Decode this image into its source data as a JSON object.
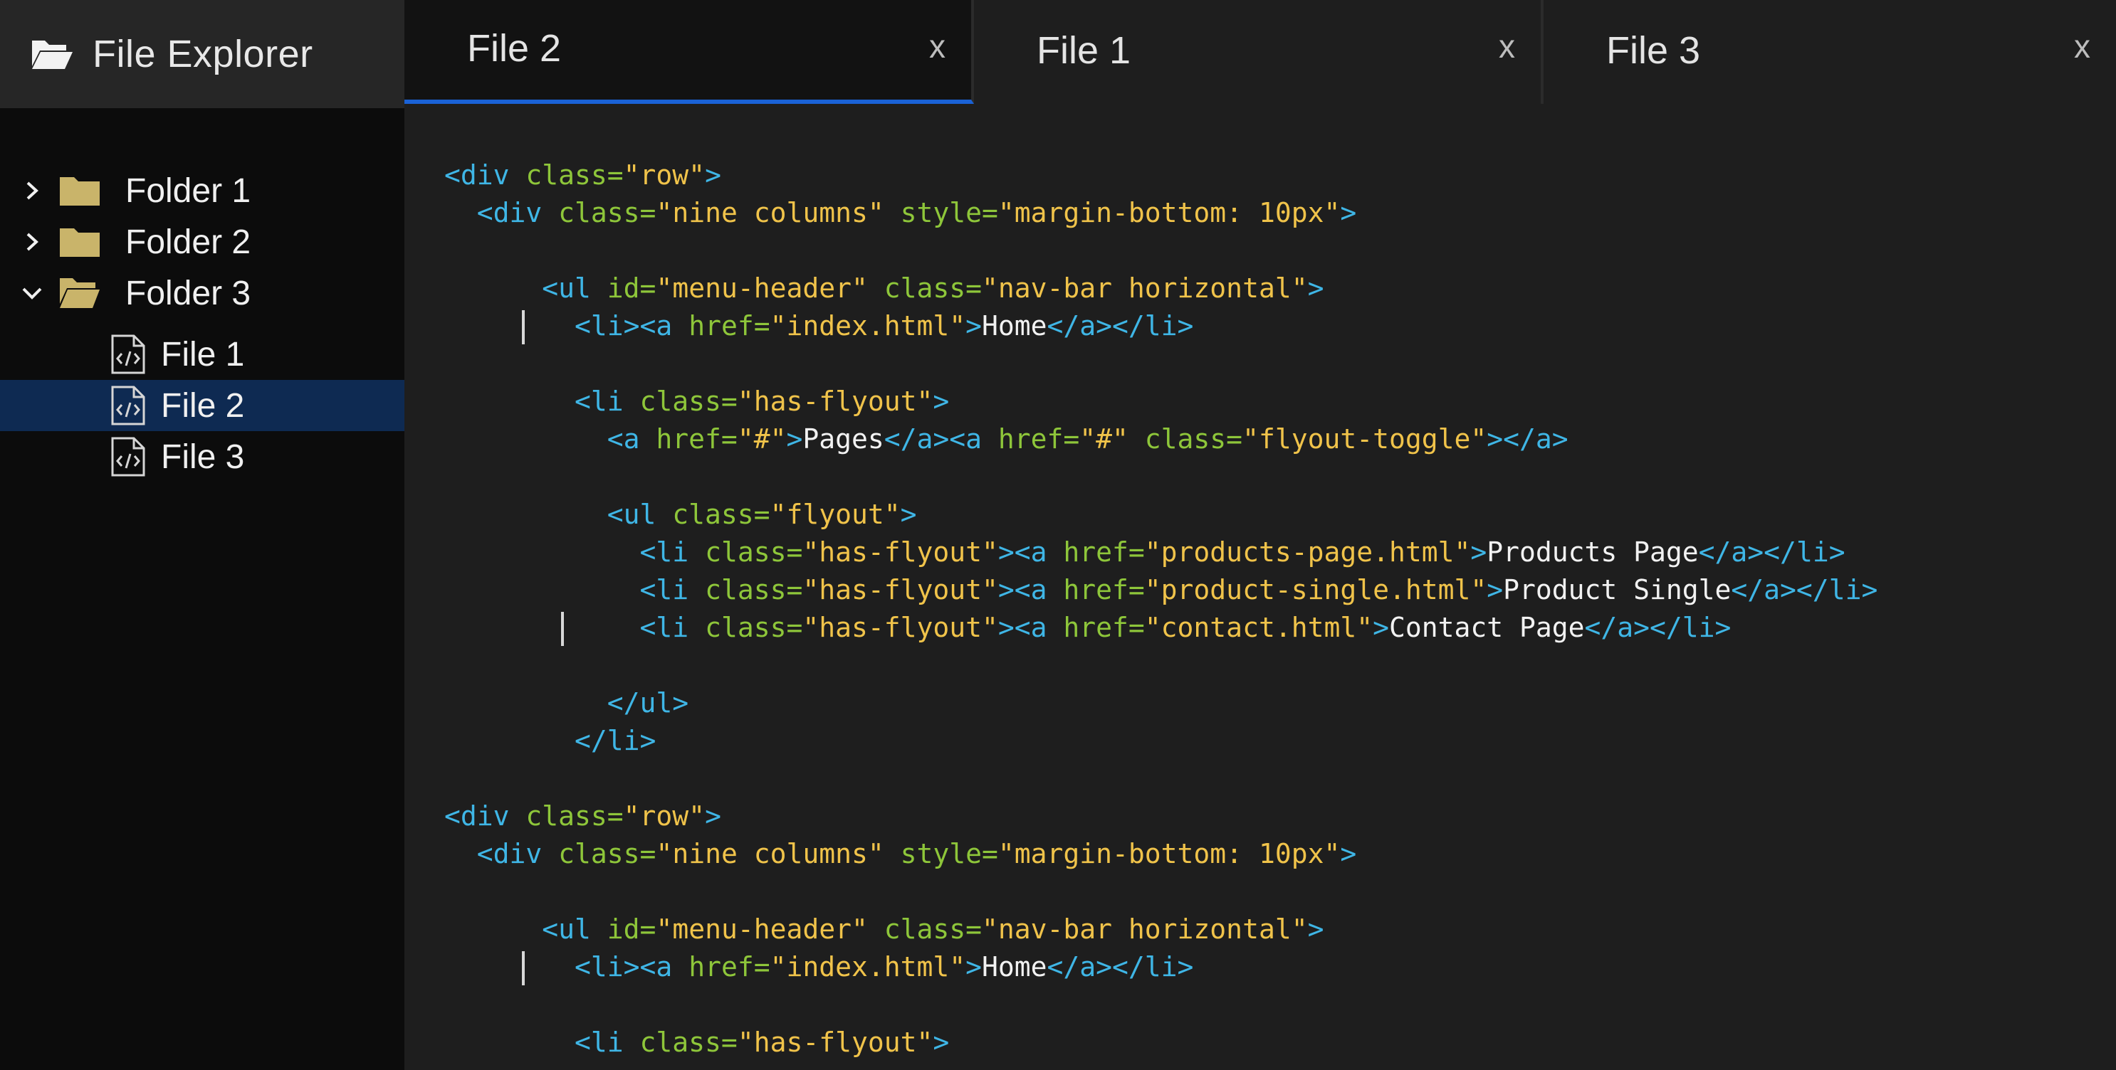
{
  "sidebar": {
    "title": "File Explorer",
    "header_icon": "folder-open-icon",
    "items": [
      {
        "type": "folder",
        "label": "Folder 1",
        "expanded": false
      },
      {
        "type": "folder",
        "label": "Folder 2",
        "expanded": false
      },
      {
        "type": "folder",
        "label": "Folder 3",
        "expanded": true
      },
      {
        "type": "file",
        "label": "File 1",
        "selected": false
      },
      {
        "type": "file",
        "label": "File 2",
        "selected": true
      },
      {
        "type": "file",
        "label": "File 3",
        "selected": false
      }
    ]
  },
  "tabs": [
    {
      "label": "File 2",
      "close": "x",
      "active": true
    },
    {
      "label": "File 1",
      "close": "x",
      "active": false
    },
    {
      "label": "File 3",
      "close": "x",
      "active": false
    }
  ],
  "colors": {
    "accent": "#1a62d6",
    "selected_row": "#0e2a52",
    "folder": "#c9b46a",
    "tag": "#3fb6e6",
    "attr": "#8ec63a",
    "string": "#f0c34a",
    "text": "#f2f2f2"
  },
  "code": {
    "lines": [
      {
        "indent": 0,
        "caret": false,
        "tokens": [
          [
            "tag",
            "<div "
          ],
          [
            "attr",
            "class="
          ],
          [
            "str",
            "\"row\""
          ],
          [
            "tag",
            ">"
          ]
        ]
      },
      {
        "indent": 1,
        "caret": false,
        "tokens": [
          [
            "tag",
            "<div "
          ],
          [
            "attr",
            "class="
          ],
          [
            "str",
            "\"nine columns\" "
          ],
          [
            "attr",
            "style="
          ],
          [
            "str",
            "\"margin-bottom: 10px\""
          ],
          [
            "tag",
            ">"
          ]
        ]
      },
      {
        "indent": 0,
        "caret": false,
        "tokens": []
      },
      {
        "indent": 3,
        "caret": false,
        "tokens": [
          [
            "tag",
            "<ul "
          ],
          [
            "attr",
            "id="
          ],
          [
            "str",
            "\"menu-header\" "
          ],
          [
            "attr",
            "class="
          ],
          [
            "str",
            "\"nav-bar horizontal\""
          ],
          [
            "tag",
            ">"
          ]
        ]
      },
      {
        "indent": 4,
        "caret": true,
        "tokens": [
          [
            "tag",
            "<li><a "
          ],
          [
            "attr",
            "href="
          ],
          [
            "str",
            "\"index.html\""
          ],
          [
            "tag",
            ">"
          ],
          [
            "txt",
            "Home"
          ],
          [
            "tag",
            "</a></li>"
          ]
        ]
      },
      {
        "indent": 0,
        "caret": false,
        "tokens": []
      },
      {
        "indent": 4,
        "caret": false,
        "tokens": [
          [
            "tag",
            "<li "
          ],
          [
            "attr",
            "class="
          ],
          [
            "str",
            "\"has-flyout\""
          ],
          [
            "tag",
            ">"
          ]
        ]
      },
      {
        "indent": 5,
        "caret": false,
        "tokens": [
          [
            "tag",
            "<a "
          ],
          [
            "attr",
            "href="
          ],
          [
            "str",
            "\"#\""
          ],
          [
            "tag",
            ">"
          ],
          [
            "txt",
            "Pages"
          ],
          [
            "tag",
            "</a><a "
          ],
          [
            "attr",
            "href="
          ],
          [
            "str",
            "\"#\" "
          ],
          [
            "attr",
            "class="
          ],
          [
            "str",
            "\"flyout-toggle\""
          ],
          [
            "tag",
            "></a>"
          ]
        ]
      },
      {
        "indent": 0,
        "caret": false,
        "tokens": []
      },
      {
        "indent": 5,
        "caret": false,
        "tokens": [
          [
            "tag",
            "<ul "
          ],
          [
            "attr",
            "class="
          ],
          [
            "str",
            "\"flyout\""
          ],
          [
            "tag",
            ">"
          ]
        ]
      },
      {
        "indent": 6,
        "caret": false,
        "tokens": [
          [
            "tag",
            "<li "
          ],
          [
            "attr",
            "class="
          ],
          [
            "str",
            "\"has-flyout\""
          ],
          [
            "tag",
            "><a "
          ],
          [
            "attr",
            "href="
          ],
          [
            "str",
            "\"products-page.html\""
          ],
          [
            "tag",
            ">"
          ],
          [
            "txt",
            "Products Page"
          ],
          [
            "tag",
            "</a></li>"
          ]
        ]
      },
      {
        "indent": 6,
        "caret": false,
        "tokens": [
          [
            "tag",
            "<li "
          ],
          [
            "attr",
            "class="
          ],
          [
            "str",
            "\"has-flyout\""
          ],
          [
            "tag",
            "><a "
          ],
          [
            "attr",
            "href="
          ],
          [
            "str",
            "\"product-single.html\""
          ],
          [
            "tag",
            ">"
          ],
          [
            "txt",
            "Product Single"
          ],
          [
            "tag",
            "</a></li>"
          ]
        ]
      },
      {
        "indent": 6,
        "caret": true,
        "tokens": [
          [
            "tag",
            "<li "
          ],
          [
            "attr",
            "class="
          ],
          [
            "str",
            "\"has-flyout\""
          ],
          [
            "tag",
            "><a "
          ],
          [
            "attr",
            "href="
          ],
          [
            "str",
            "\"contact.html\""
          ],
          [
            "tag",
            ">"
          ],
          [
            "txt",
            "Contact Page"
          ],
          [
            "tag",
            "</a></li>"
          ]
        ]
      },
      {
        "indent": 0,
        "caret": false,
        "tokens": []
      },
      {
        "indent": 5,
        "caret": false,
        "tokens": [
          [
            "tag",
            "</ul>"
          ]
        ]
      },
      {
        "indent": 4,
        "caret": false,
        "tokens": [
          [
            "tag",
            "</li>"
          ]
        ]
      },
      {
        "indent": 0,
        "caret": false,
        "tokens": []
      },
      {
        "indent": 0,
        "caret": false,
        "tokens": [
          [
            "tag",
            "<div "
          ],
          [
            "attr",
            "class="
          ],
          [
            "str",
            "\"row\""
          ],
          [
            "tag",
            ">"
          ]
        ]
      },
      {
        "indent": 1,
        "caret": false,
        "tokens": [
          [
            "tag",
            "<div "
          ],
          [
            "attr",
            "class="
          ],
          [
            "str",
            "\"nine columns\" "
          ],
          [
            "attr",
            "style="
          ],
          [
            "str",
            "\"margin-bottom: 10px\""
          ],
          [
            "tag",
            ">"
          ]
        ]
      },
      {
        "indent": 0,
        "caret": false,
        "tokens": []
      },
      {
        "indent": 3,
        "caret": false,
        "tokens": [
          [
            "tag",
            "<ul "
          ],
          [
            "attr",
            "id="
          ],
          [
            "str",
            "\"menu-header\" "
          ],
          [
            "attr",
            "class="
          ],
          [
            "str",
            "\"nav-bar horizontal\""
          ],
          [
            "tag",
            ">"
          ]
        ]
      },
      {
        "indent": 4,
        "caret": true,
        "tokens": [
          [
            "tag",
            "<li><a "
          ],
          [
            "attr",
            "href="
          ],
          [
            "str",
            "\"index.html\""
          ],
          [
            "tag",
            ">"
          ],
          [
            "txt",
            "Home"
          ],
          [
            "tag",
            "</a></li>"
          ]
        ]
      },
      {
        "indent": 0,
        "caret": false,
        "tokens": []
      },
      {
        "indent": 4,
        "caret": false,
        "tokens": [
          [
            "tag",
            "<li "
          ],
          [
            "attr",
            "class="
          ],
          [
            "str",
            "\"has-flyout\""
          ],
          [
            "tag",
            ">"
          ]
        ]
      }
    ]
  }
}
